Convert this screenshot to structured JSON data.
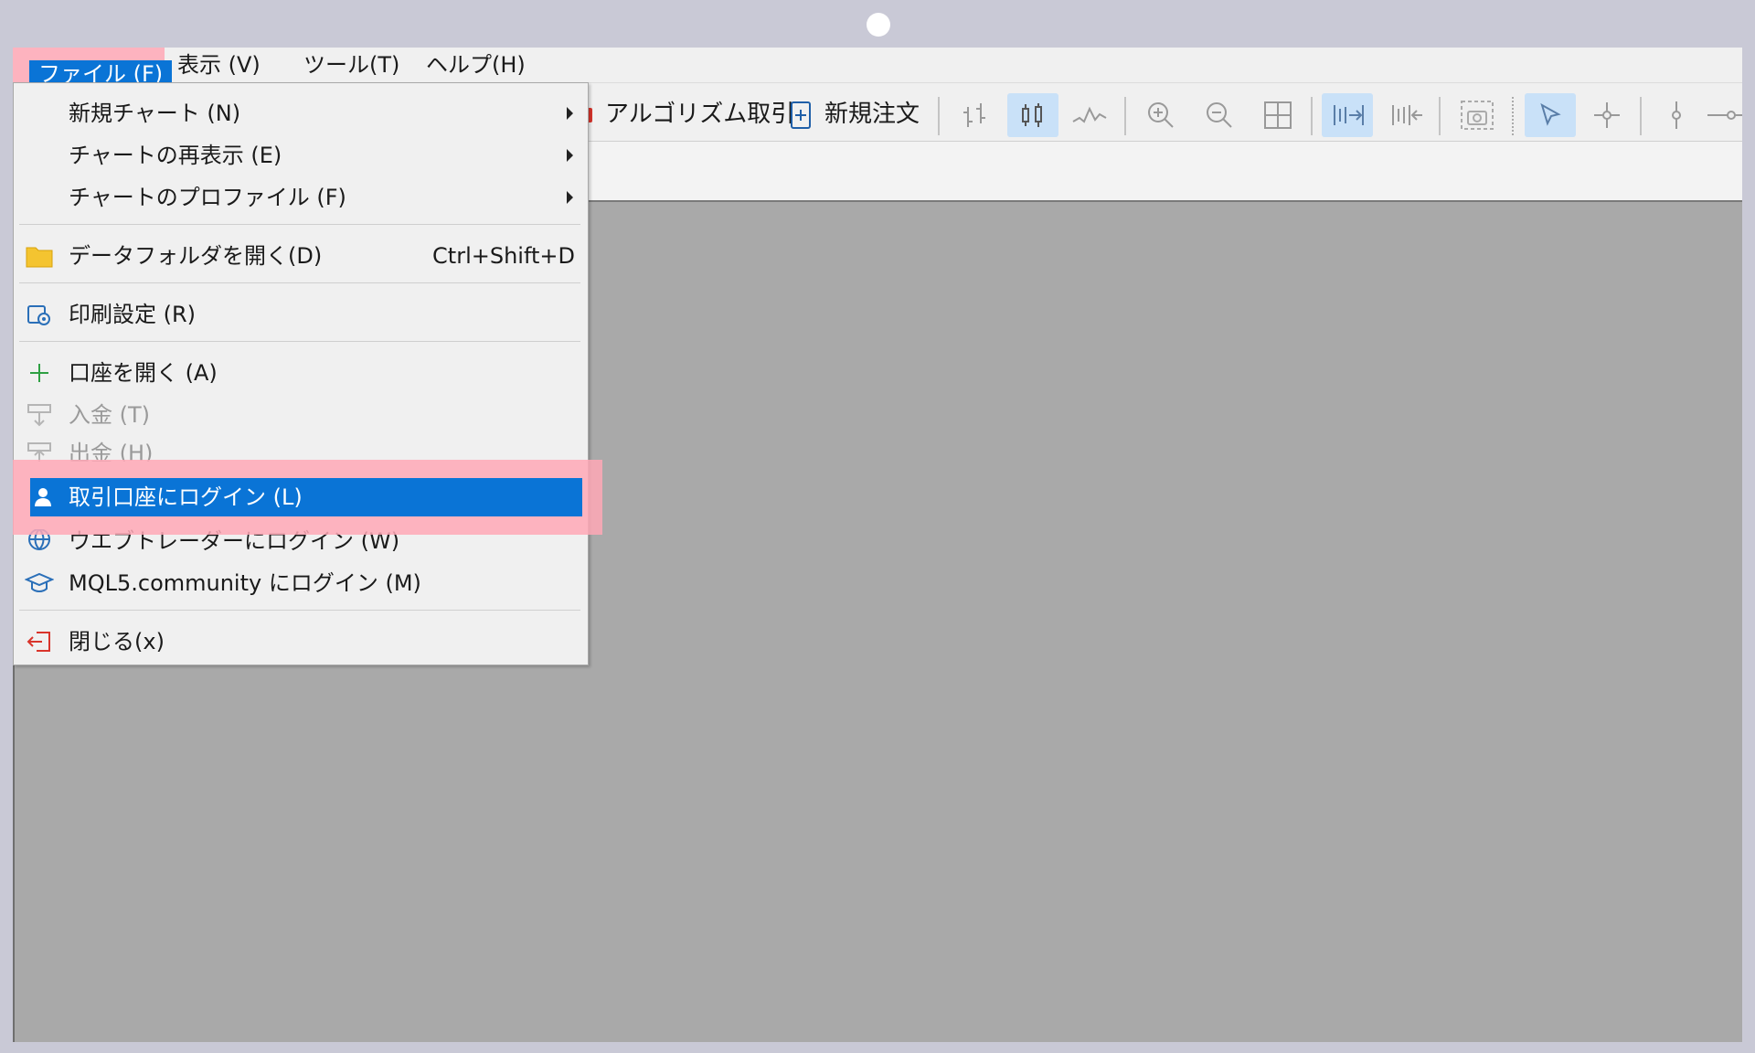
{
  "menubar": {
    "file": "ファイル (F)",
    "view": "表示 (V)",
    "tools": "ツール(T)",
    "help": "ヘルプ(H)"
  },
  "toolbar": {
    "algo_trading": "アルゴリズム取引",
    "new_order": "新規注文"
  },
  "file_menu": {
    "new_chart": "新規チャート (N)",
    "chart_redisplay": "チャートの再表示 (E)",
    "chart_profile": "チャートのプロファイル (F)",
    "open_data_folder": "データフォルダを開く(D)",
    "open_data_folder_shortcut": "Ctrl+Shift+D",
    "print_setup": "印刷設定 (R)",
    "open_account": "口座を開く (A)",
    "deposit": "入金 (T)",
    "withdraw": "出金 (H)",
    "login_trade_account": "取引口座にログイン (L)",
    "login_webtrader": "ウエブトレーダーにログイン (W)",
    "login_mql5": "MQL5.community にログイン (M)",
    "close": "閉じる(x)"
  },
  "colors": {
    "accent": "#0a74d6",
    "highlight": "#ffa8b6",
    "chart_bg": "#a9a9a9"
  }
}
